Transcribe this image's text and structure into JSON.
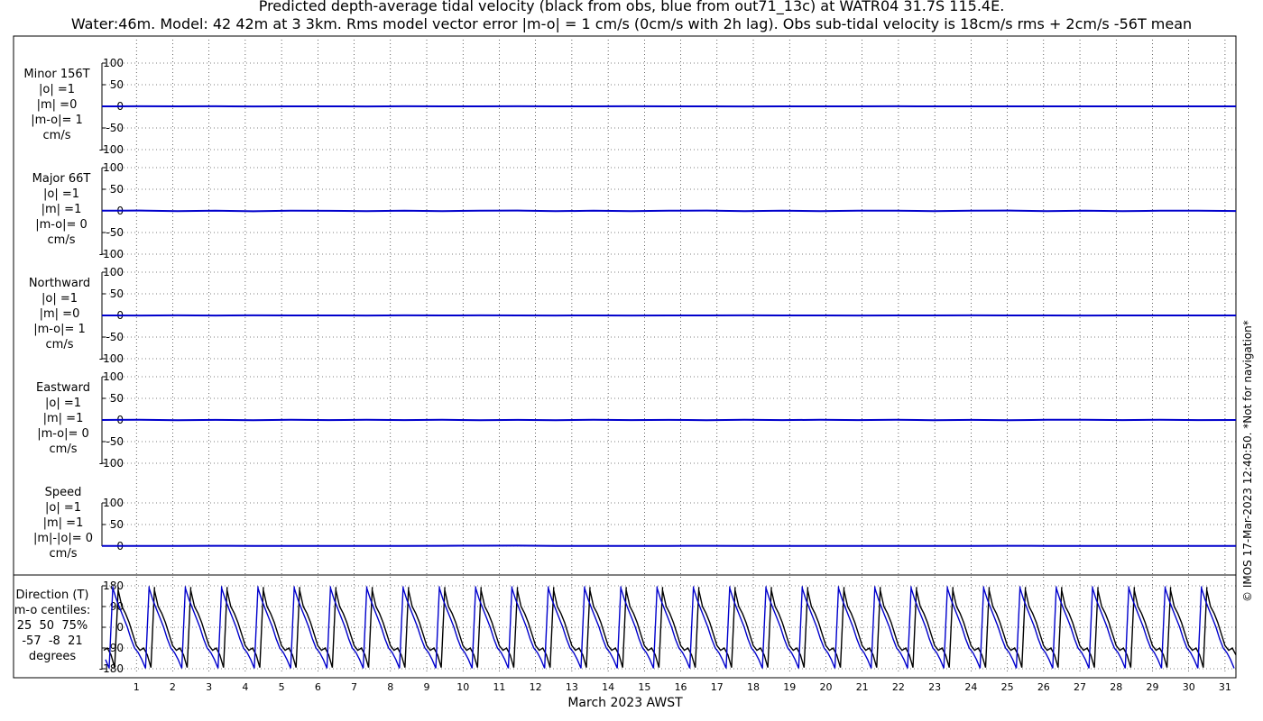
{
  "title_line1": "Predicted depth-average tidal velocity (black from obs, blue from out71_13c) at WATR04 31.7S 115.4E.",
  "title_line2": "Water:46m. Model: 42 42m at 3 3km. Rms model vector error |m-o| = 1 cm/s (0cm/s with 2h lag). Obs sub-tidal velocity is 18cm/s rms + 2cm/s -56T mean",
  "credit": "© IMOS 17-Mar-2023 12:40:50. *Not for navigation*",
  "chart_data": [
    {
      "type": "line",
      "panel": "minor",
      "label_lines": [
        "Minor 156T",
        "|o| =1",
        "|m| =0",
        "|m-o|= 1",
        "cm/s"
      ],
      "ylim": [
        -100,
        100
      ],
      "yticks": [
        "100",
        "50",
        "0",
        "-50",
        "-100"
      ],
      "series": [
        {
          "color": "#000000",
          "values": [
            0,
            0.6,
            -0.4,
            0.8,
            -0.5,
            0.4,
            0,
            -0.6,
            0.5,
            0.3,
            -0.3,
            0.6,
            -0.4,
            0.2,
            0.5,
            -0.2,
            0.4,
            -0.5,
            0.3,
            0.2,
            -0.3,
            0.5,
            0.1,
            -0.4,
            0.2,
            0.3,
            -0.2,
            0.4,
            -0.1,
            0.2,
            0
          ]
        },
        {
          "color": "#0000cc",
          "values": [
            0,
            0.2,
            -0.1,
            0.2,
            -0.2,
            0.1,
            0,
            -0.2,
            0.2,
            0.1,
            -0.1,
            0.2,
            -0.1,
            0.1,
            0.2,
            -0.1,
            0.1,
            -0.2,
            0.1,
            0.1,
            -0.1,
            0.2,
            0,
            -0.1,
            0.1,
            0.1,
            -0.1,
            0.1,
            0,
            0.1,
            0
          ]
        }
      ]
    },
    {
      "type": "line",
      "panel": "major",
      "label_lines": [
        "Major 66T",
        "|o| =1",
        "|m| =1",
        "|m-o|= 0",
        "cm/s"
      ],
      "ylim": [
        -100,
        100
      ],
      "yticks": [
        "100",
        "50",
        "0",
        "-50",
        "-100"
      ],
      "series": [
        {
          "color": "#000000",
          "values": [
            0.5,
            1,
            -0.8,
            0.6,
            -1,
            0.7,
            0.4,
            -0.6,
            0.8,
            -0.5,
            0.6,
            1,
            -0.7,
            0.5,
            -0.8,
            0.6,
            0.9,
            -0.6,
            0.7,
            -0.5,
            0.6,
            0.8,
            -0.7,
            0.5,
            1,
            -0.6,
            0.7,
            -0.8,
            0.6,
            0.5,
            -0.4
          ]
        },
        {
          "color": "#0000cc",
          "values": [
            0.4,
            0.9,
            -0.7,
            0.5,
            -0.9,
            0.6,
            0.3,
            -0.5,
            0.7,
            -0.4,
            0.5,
            0.9,
            -0.6,
            0.4,
            -0.7,
            0.5,
            0.8,
            -0.5,
            0.6,
            -0.4,
            0.5,
            0.7,
            -0.6,
            0.4,
            0.9,
            -0.5,
            0.6,
            -0.7,
            0.5,
            0.4,
            -0.3
          ]
        }
      ]
    },
    {
      "type": "line",
      "panel": "northward",
      "label_lines": [
        "Northward",
        "|o| =1",
        "|m| =0",
        "|m-o|= 1",
        "cm/s"
      ],
      "ylim": [
        -100,
        100
      ],
      "yticks": [
        "100",
        "50",
        "0",
        "-50",
        "-100"
      ],
      "series": [
        {
          "color": "#000000",
          "values": [
            0,
            -0.5,
            0.4,
            -0.6,
            0.5,
            -0.3,
            0.2,
            -0.5,
            0.4,
            -0.2,
            0.6,
            0.3,
            -0.4,
            0.3,
            -0.5,
            0.2,
            -0.3,
            0.4,
            -0.2,
            0.3,
            -0.4,
            0.2,
            -0.3,
            0.4,
            -0.2,
            0.3,
            -0.4,
            0.2,
            -0.3,
            0.2,
            0
          ]
        },
        {
          "color": "#0000cc",
          "values": [
            0,
            -0.2,
            0.2,
            -0.2,
            0.2,
            -0.1,
            0.1,
            -0.2,
            0.2,
            -0.1,
            0.2,
            0.1,
            -0.2,
            0.1,
            -0.2,
            0.1,
            -0.1,
            0.2,
            -0.1,
            0.1,
            -0.2,
            0.1,
            -0.1,
            0.2,
            -0.1,
            0.1,
            -0.2,
            0.1,
            -0.1,
            0.1,
            0
          ]
        }
      ]
    },
    {
      "type": "line",
      "panel": "eastward",
      "label_lines": [
        "Eastward",
        "|o| =1",
        "|m| =1",
        "|m-o|= 0",
        "cm/s"
      ],
      "ylim": [
        -100,
        100
      ],
      "yticks": [
        "100",
        "50",
        "0",
        "-50",
        "-100"
      ],
      "series": [
        {
          "color": "#000000",
          "values": [
            0,
            0.5,
            -0.6,
            0.4,
            -0.5,
            0.6,
            -0.3,
            0.5,
            -0.4,
            0.6,
            -0.5,
            0.4,
            -0.6,
            0.5,
            -0.3,
            0.4,
            -0.5,
            0.6,
            -0.4,
            0.5,
            -0.3,
            0.6,
            -0.5,
            0.4,
            -0.6,
            0.5,
            0.9,
            -0.4,
            0.5,
            -0.3,
            0
          ]
        },
        {
          "color": "#0000cc",
          "values": [
            0,
            0.4,
            -0.5,
            0.3,
            -0.4,
            0.5,
            -0.2,
            0.4,
            -0.3,
            0.5,
            -0.4,
            0.3,
            -0.5,
            0.4,
            -0.2,
            0.3,
            -0.4,
            0.5,
            -0.3,
            0.4,
            -0.2,
            0.5,
            -0.4,
            0.3,
            -0.5,
            0.4,
            0.7,
            -0.3,
            0.4,
            -0.2,
            0
          ]
        }
      ]
    },
    {
      "type": "line",
      "panel": "speed",
      "label_lines": [
        "Speed",
        "|o| =1",
        "|m| =1",
        "|m|-|o|= 0",
        "cm/s"
      ],
      "ylim": [
        0,
        100
      ],
      "yticks": [
        "100",
        "50",
        "0"
      ],
      "series": [
        {
          "color": "#000000",
          "values": [
            0.5,
            0.8,
            0.4,
            0.9,
            0.6,
            0.5,
            0.8,
            0.4,
            0.7,
            0.9,
            1.2,
            1.5,
            0.6,
            0.8,
            0.5,
            0.7,
            0.9,
            0.6,
            0.8,
            0.5,
            0.6,
            0.8,
            0.5,
            0.7,
            0.9,
            0.6,
            0.8,
            0.5,
            0.7,
            0.6,
            0.5
          ]
        },
        {
          "color": "#0000cc",
          "values": [
            0.5,
            0.7,
            0.5,
            0.8,
            0.6,
            0.5,
            0.7,
            0.5,
            0.7,
            0.8,
            1.0,
            1.2,
            0.6,
            0.7,
            0.5,
            0.7,
            0.8,
            0.6,
            0.7,
            0.5,
            0.6,
            0.7,
            0.5,
            0.7,
            0.8,
            0.6,
            0.7,
            0.5,
            0.7,
            0.6,
            0.5
          ]
        }
      ]
    },
    {
      "type": "line",
      "panel": "direction",
      "label_lines": [
        "Direction (T)",
        "m-o centiles:",
        "25  50  75%",
        "-57  -8  21",
        "degrees"
      ],
      "ylim": [
        -180,
        180
      ],
      "yticks": [
        "180",
        "90",
        "0",
        "-90",
        "-180"
      ],
      "tidal_period_days": 1.0,
      "series": [
        {
          "name": "obs",
          "color": "#000000",
          "cycle": [
            160,
            90,
            60,
            20,
            -30,
            -80,
            -100,
            -90,
            -120,
            -175,
            175
          ]
        },
        {
          "name": "model",
          "color": "#0000cc",
          "cycle": [
            170,
            120,
            80,
            40,
            0,
            -50,
            -90,
            -110,
            -140,
            -178,
            178
          ]
        }
      ],
      "phase_offsets_days": {
        "obs": 0.5,
        "model": 0.35
      }
    }
  ],
  "x_axis": {
    "ticks": [
      "1",
      "2",
      "3",
      "4",
      "5",
      "6",
      "7",
      "8",
      "9",
      "10",
      "11",
      "12",
      "13",
      "14",
      "15",
      "16",
      "17",
      "18",
      "19",
      "20",
      "21",
      "22",
      "23",
      "24",
      "25",
      "26",
      "27",
      "28",
      "29",
      "30",
      "31"
    ],
    "xlabel": "March 2023 AWST",
    "xlim_days": [
      0.05,
      31.3
    ]
  }
}
